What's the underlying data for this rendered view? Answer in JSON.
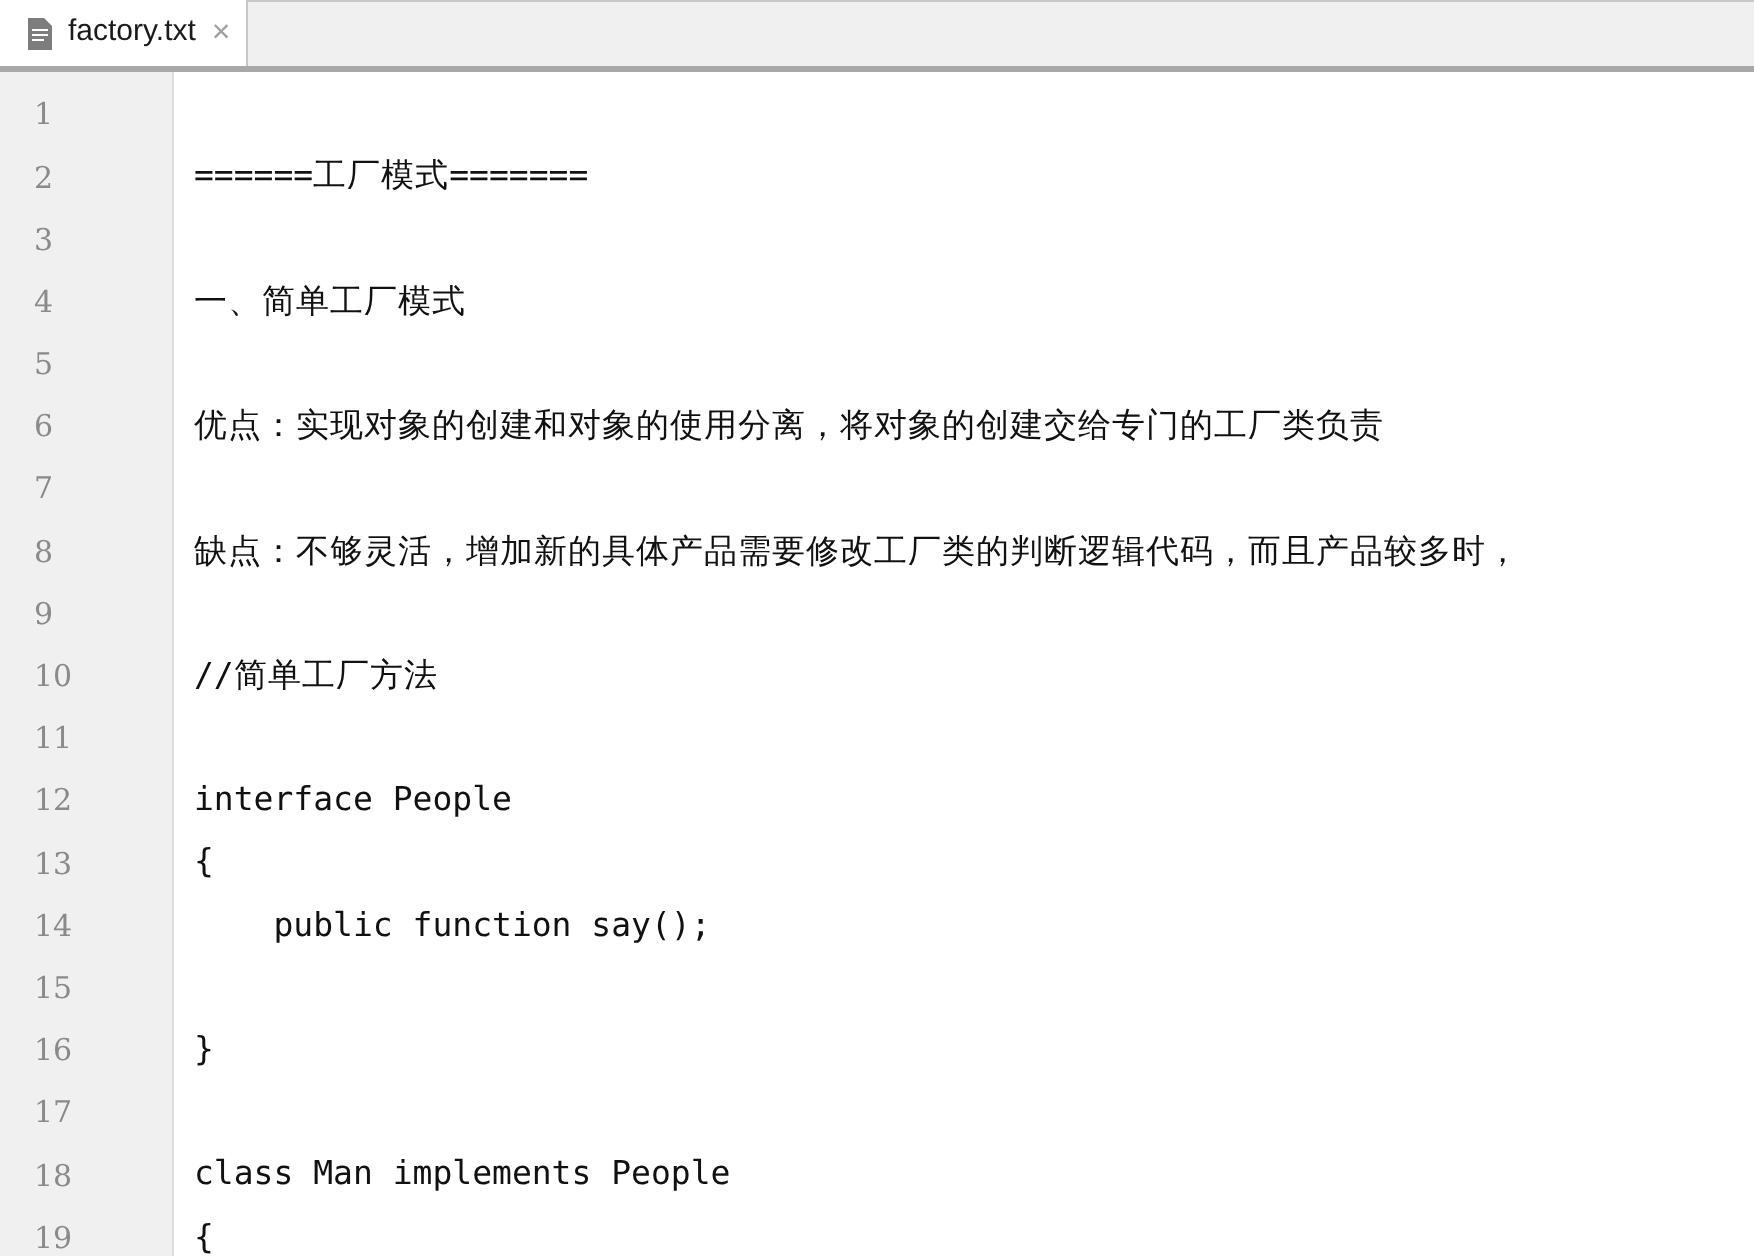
{
  "tabs": [
    {
      "label": "factory.txt",
      "selected": true,
      "close": "×"
    }
  ],
  "lines": [
    {
      "number": "1"
    },
    {
      "number": "2",
      "text": "======工厂模式======="
    },
    {
      "number": "3"
    },
    {
      "number": "4",
      "text": "一、简单工厂模式"
    },
    {
      "number": "5"
    },
    {
      "number": "6",
      "text": "优点：实现对象的创建和对象的使用分离，将对象的创建交给专门的工厂类负责"
    },
    {
      "number": "7"
    },
    {
      "number": "8",
      "text": "缺点：不够灵活，增加新的具体产品需要修改工厂类的判断逻辑代码，而且产品较多时，"
    },
    {
      "number": "9"
    },
    {
      "number": "10",
      "text": "//简单工厂方法"
    },
    {
      "number": "11"
    },
    {
      "number": "12",
      "text": "interface People"
    },
    {
      "number": "13",
      "text": "{"
    },
    {
      "number": "14",
      "text": "    public function say();"
    },
    {
      "number": "15"
    },
    {
      "number": "16",
      "text": "}"
    },
    {
      "number": "17"
    },
    {
      "number": "18",
      "text": "class Man implements People"
    },
    {
      "number": "19",
      "text": "{"
    }
  ]
}
